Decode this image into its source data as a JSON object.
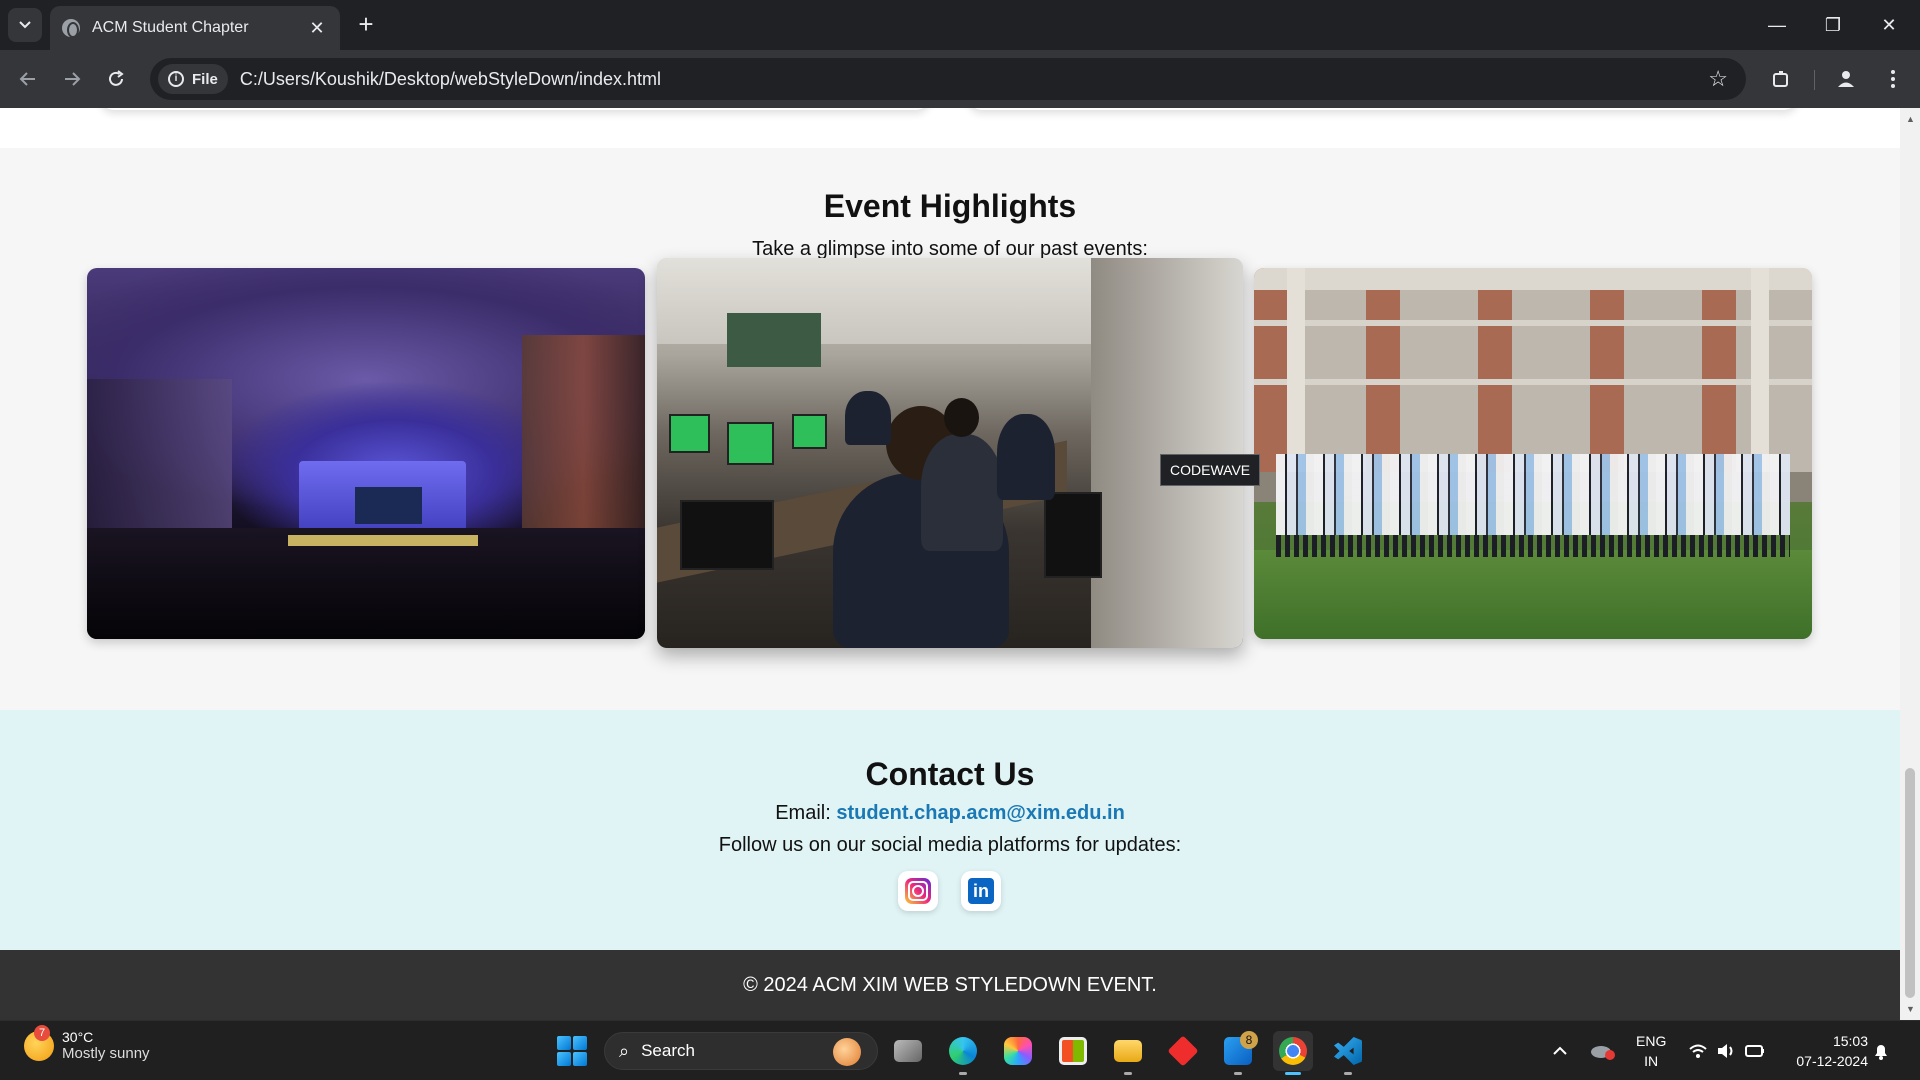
{
  "browser": {
    "tab_title": "ACM Student Chapter",
    "close_tab_glyph": "✕",
    "new_tab_glyph": "+",
    "chip_label": "File",
    "url": "C:/Users/Koushik/Desktop/webStyleDown/index.html",
    "window_controls": {
      "minimize": "—",
      "restore": "❐",
      "close": "✕"
    }
  },
  "highlights": {
    "title": "Event Highlights",
    "subtitle": "Take a glimpse into some of our past events:",
    "photos": [
      {
        "name": "auditorium-photo"
      },
      {
        "name": "codewave-lab-photo",
        "tooltip": "CODEWAVE"
      },
      {
        "name": "group-photo"
      }
    ]
  },
  "contact": {
    "title": "Contact Us",
    "email_label": "Email:",
    "email": "student.chap.acm@xim.edu.in",
    "follow_text": "Follow us on our social media platforms for updates:",
    "social": [
      {
        "icon": "instagram-icon"
      },
      {
        "icon": "linkedin-icon",
        "glyph": "in"
      }
    ]
  },
  "footer": {
    "text": "© 2024 ACM XIM WEB STYLEDOWN EVENT."
  },
  "taskbar": {
    "weather": {
      "badge": "7",
      "temp": "30°C",
      "condition": "Mostly sunny"
    },
    "search_placeholder": "Search",
    "files_badge": "8",
    "lang_top": "ENG",
    "lang_bottom": "IN",
    "time": "15:03",
    "date": "07-12-2024"
  },
  "colors": {
    "link": "#1a78b4",
    "contact_bg": "#e0f4f6",
    "footer_bg": "#333333"
  }
}
